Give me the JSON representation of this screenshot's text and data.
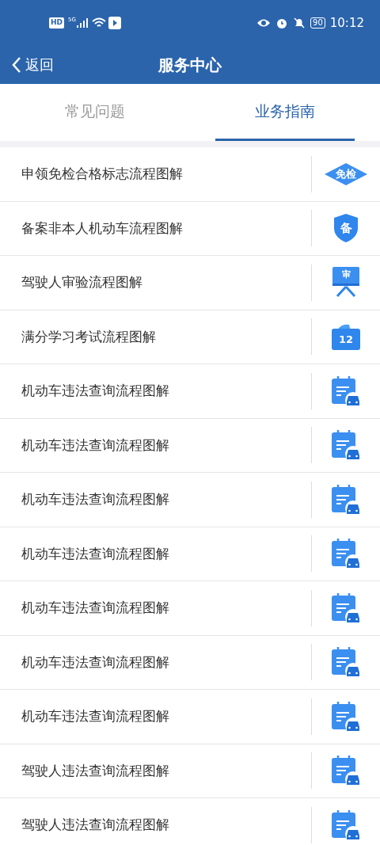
{
  "status_bar": {
    "hd": "HD",
    "network": "5G",
    "battery": "90",
    "time": "10:12"
  },
  "header": {
    "back": "返回",
    "title": "服务中心"
  },
  "tabs": [
    {
      "label": "常见问题",
      "selected": false
    },
    {
      "label": "业务指南",
      "selected": true
    }
  ],
  "items": [
    {
      "title": "申领免检合格标志流程图解",
      "kind": "diamond",
      "icon_text": "免检"
    },
    {
      "title": "备案非本人机动车流程图解",
      "kind": "shield",
      "icon_text": "备"
    },
    {
      "title": "驾驶人审验流程图解",
      "kind": "board",
      "icon_text": "审"
    },
    {
      "title": "满分学习考试流程图解",
      "kind": "folder",
      "icon_text": "12"
    },
    {
      "title": "机动车违法查询流程图解",
      "kind": "doc-car"
    },
    {
      "title": "机动车违法查询流程图解",
      "kind": "doc-car"
    },
    {
      "title": "机动车违法查询流程图解",
      "kind": "doc-car"
    },
    {
      "title": "机动车违法查询流程图解",
      "kind": "doc-car"
    },
    {
      "title": "机动车违法查询流程图解",
      "kind": "doc-car"
    },
    {
      "title": "机动车违法查询流程图解",
      "kind": "doc-car"
    },
    {
      "title": "机动车违法查询流程图解",
      "kind": "doc-car"
    },
    {
      "title": "驾驶人违法查询流程图解",
      "kind": "doc-car"
    },
    {
      "title": "驾驶人违法查询流程图解",
      "kind": "doc-car"
    }
  ]
}
